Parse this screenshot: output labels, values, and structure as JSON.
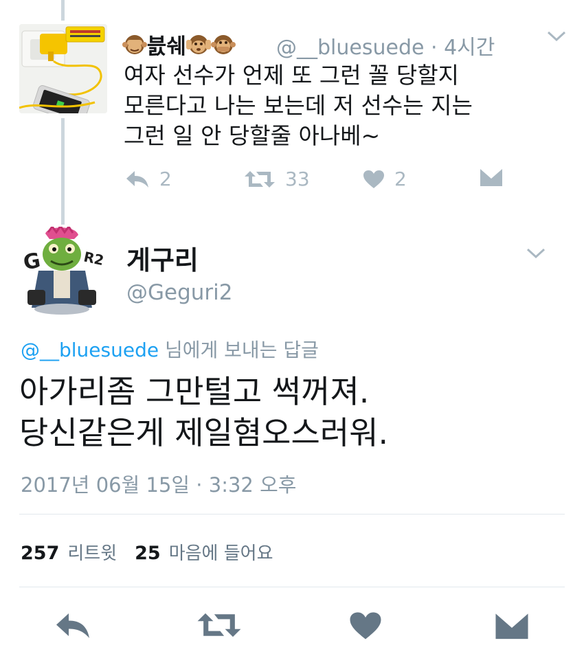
{
  "parent_tweet": {
    "display_name": "븘쉐",
    "handle": "@__bluesuede",
    "time": "· 4시간",
    "text_lines": [
      "여자 선수가 언제 또 그런 꼴 당할지",
      "모른다고 나는 보는데 저 선수는 지는",
      "그런 일 안 당할줄 아나베~"
    ],
    "replies": "2",
    "retweets": "33",
    "likes": "2",
    "avatar_icon": "phone-charger-photo"
  },
  "main_tweet": {
    "display_name": "게구리",
    "handle": "@Geguri2",
    "reply_to_handle": "@__bluesuede",
    "reply_to_suffix": " 님에게 보내는 답글",
    "text_lines": [
      "아가리좀 그만털고 썩꺼져.",
      "당신같은게 제일혐오스러워."
    ],
    "timestamp": "2017년 06월 15일 · 3:32 오후",
    "retweet_count": "257",
    "retweet_label": "리트윗",
    "like_count": "25",
    "like_label": "마음에 들어요",
    "avatar_icon": "geguri-frog-avatar"
  },
  "colors": {
    "text": "#14171a",
    "secondary": "#8899a6",
    "link": "#1da1f2",
    "icon": "#aab8c2"
  }
}
